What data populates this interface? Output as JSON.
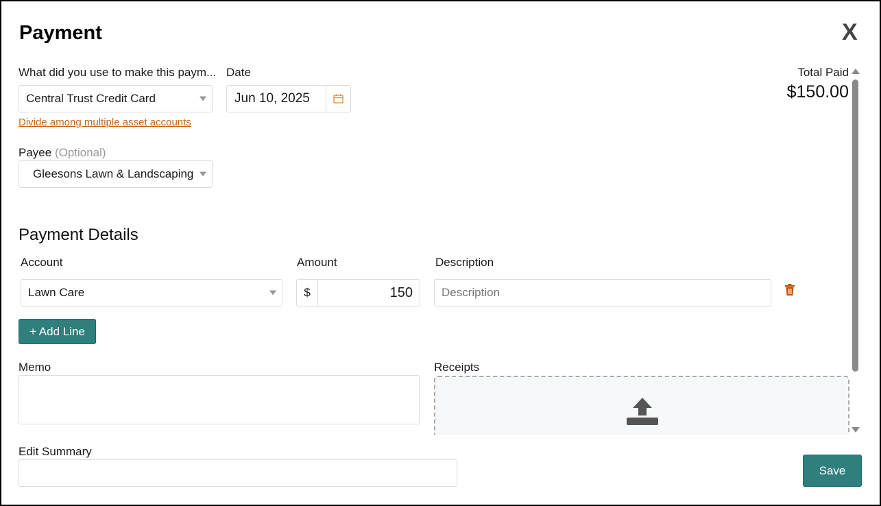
{
  "dialog": {
    "title": "Payment",
    "close_label": "X"
  },
  "payment_method": {
    "label": "What did you use to make this paym...",
    "value": "Central Trust Credit Card",
    "divide_link": "Divide among multiple asset accounts"
  },
  "date": {
    "label": "Date",
    "value": "Jun 10, 2025"
  },
  "total": {
    "label": "Total Paid",
    "value": "$150.00"
  },
  "payee": {
    "label": "Payee",
    "optional": "(Optional)",
    "value": "Gleesons Lawn & Landscaping"
  },
  "details": {
    "heading": "Payment Details",
    "columns": {
      "account": "Account",
      "amount": "Amount",
      "description": "Description"
    },
    "lines": [
      {
        "account": "Lawn Care",
        "currency": "$",
        "amount": "150",
        "description_placeholder": "Description"
      }
    ],
    "add_line_label": "+ Add Line"
  },
  "memo": {
    "label": "Memo",
    "value": ""
  },
  "receipts": {
    "label": "Receipts"
  },
  "edit_summary": {
    "label": "Edit Summary",
    "value": ""
  },
  "save_label": "Save",
  "colors": {
    "accent": "#2f7f7f",
    "link": "#c0651a",
    "trash": "#c0550e"
  }
}
